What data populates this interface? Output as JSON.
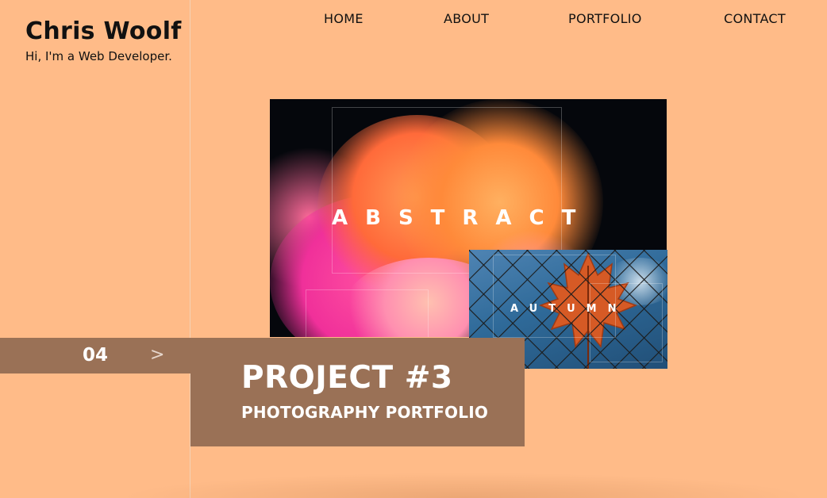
{
  "brand": {
    "name": "Chris Woolf",
    "tagline": "Hi, I'm a Web Developer."
  },
  "nav": {
    "items": [
      {
        "label": "HOME"
      },
      {
        "label": "ABOUT"
      },
      {
        "label": "PORTFOLIO"
      },
      {
        "label": "CONTACT"
      }
    ]
  },
  "gallery": {
    "abstract_title": "ABSTRACT",
    "autumn_title": "AUTUMN"
  },
  "slider": {
    "number": "04",
    "next_label": ">"
  },
  "project": {
    "title": "PROJECT #3",
    "subtitle": "PHOTOGRAPHY PORTFOLIO"
  },
  "colors": {
    "background": "#ffbb88",
    "card": "#9a7156",
    "text": "#111111"
  }
}
